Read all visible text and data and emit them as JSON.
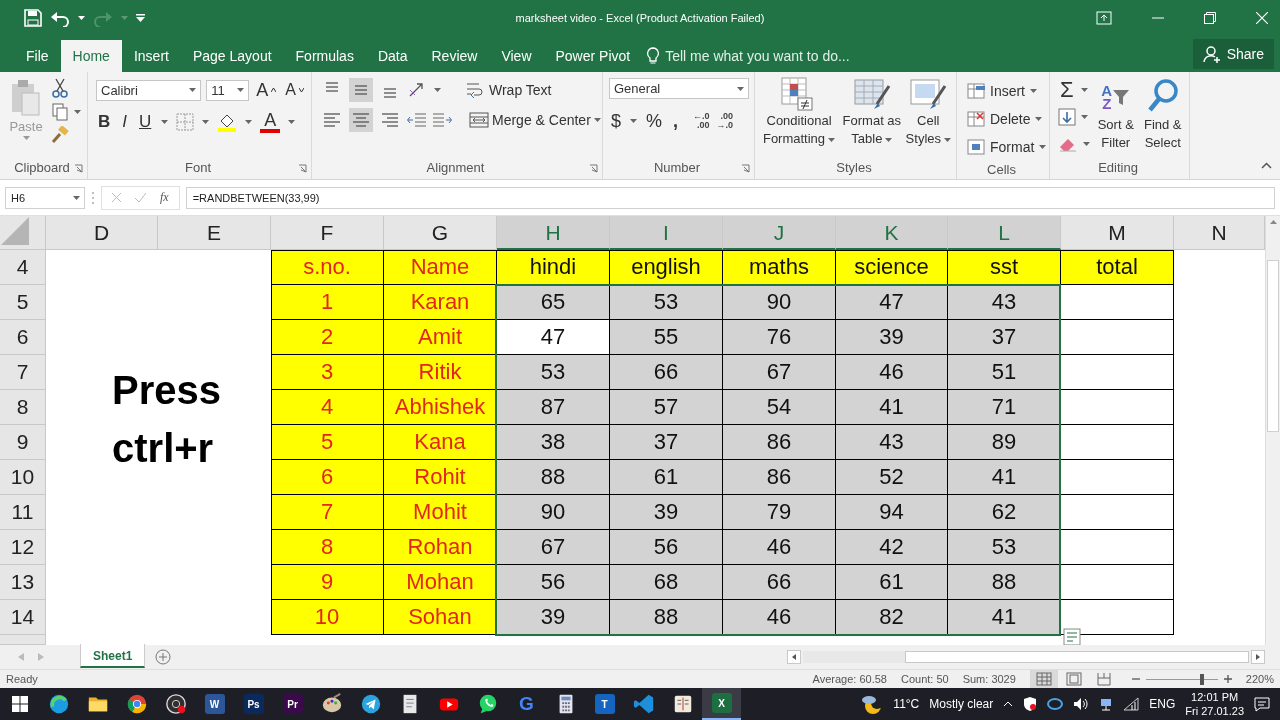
{
  "window": {
    "title": "marksheet video - Excel (Product Activation Failed)"
  },
  "quick_access": {
    "redo_disabled": true
  },
  "ribbon_tabs": [
    {
      "label": "File",
      "selected": false
    },
    {
      "label": "Home",
      "selected": true
    },
    {
      "label": "Insert",
      "selected": false
    },
    {
      "label": "Page Layout",
      "selected": false
    },
    {
      "label": "Formulas",
      "selected": false
    },
    {
      "label": "Data",
      "selected": false
    },
    {
      "label": "Review",
      "selected": false
    },
    {
      "label": "View",
      "selected": false
    },
    {
      "label": "Power Pivot",
      "selected": false
    }
  ],
  "tell_me": {
    "placeholder": "Tell me what you want to do..."
  },
  "share": {
    "label": "Share"
  },
  "ribbon": {
    "clipboard": {
      "label": "Clipboard",
      "paste": {
        "label": "Paste",
        "disabled": true
      }
    },
    "font": {
      "label": "Font",
      "font_name": "Calibri",
      "font_size": "11",
      "grow": "A",
      "shrink": "A",
      "bold": "B",
      "italic": "I",
      "underline": "U",
      "font_color": "A"
    },
    "alignment": {
      "label": "Alignment",
      "vertical": [
        {
          "kind": "top",
          "selected": false
        },
        {
          "kind": "middle",
          "selected": true
        },
        {
          "kind": "bottom",
          "selected": false
        }
      ],
      "horizontal": [
        {
          "kind": "left",
          "selected": false
        },
        {
          "kind": "center",
          "selected": true
        },
        {
          "kind": "right",
          "selected": false
        }
      ],
      "wrap_text": "Wrap Text",
      "merge_center": "Merge & Center"
    },
    "number": {
      "label": "Number",
      "format": "General",
      "currency": "$",
      "percent": "%",
      "comma": ",",
      "increase_decimal": [
        "←.0",
        ".00"
      ],
      "decrease_decimal": [
        ".00",
        "→.0"
      ]
    },
    "styles": {
      "label": "Styles",
      "buttons": [
        {
          "kind": "conditional",
          "label": "Conditional Formatting"
        },
        {
          "kind": "table",
          "label": "Format as Table"
        },
        {
          "kind": "cell",
          "label": "Cell Styles"
        }
      ]
    },
    "cells": {
      "label": "Cells",
      "buttons": [
        {
          "kind": "insert",
          "label": "Insert"
        },
        {
          "kind": "delete",
          "label": "Delete"
        },
        {
          "kind": "format",
          "label": "Format"
        }
      ]
    },
    "editing": {
      "label": "Editing",
      "autosum": "Σ",
      "sort": {
        "label": "Sort & Filter",
        "glyphs": [
          "A",
          "Z"
        ]
      },
      "find": {
        "label": "Find & Select"
      }
    }
  },
  "formula_bar": {
    "name_box": "H6",
    "fx": "fx",
    "formula": "=RANDBETWEEN(33,99)"
  },
  "columns": [
    {
      "label": "D",
      "selected": false
    },
    {
      "label": "E",
      "selected": false
    },
    {
      "label": "F",
      "selected": false
    },
    {
      "label": "G",
      "selected": false
    },
    {
      "label": "H",
      "selected": true
    },
    {
      "label": "I",
      "selected": true
    },
    {
      "label": "J",
      "selected": true
    },
    {
      "label": "K",
      "selected": true
    },
    {
      "label": "L",
      "selected": true
    },
    {
      "label": "M",
      "selected": false
    },
    {
      "label": "N",
      "selected": false
    }
  ],
  "table": {
    "header_row": "4",
    "header": [
      "s.no.",
      "Name",
      "hindi",
      "english",
      "maths",
      "science",
      "sst",
      "total"
    ],
    "rows": [
      {
        "row": "5",
        "sno": "1",
        "name": "Karan",
        "marks": [
          {
            "value": "65",
            "selected": true,
            "active": false
          },
          {
            "value": "53",
            "selected": true,
            "active": false
          },
          {
            "value": "90",
            "selected": true,
            "active": false
          },
          {
            "value": "47",
            "selected": true,
            "active": false
          },
          {
            "value": "43",
            "selected": true,
            "active": false
          }
        ]
      },
      {
        "row": "6",
        "sno": "2",
        "name": "Amit",
        "marks": [
          {
            "value": "47",
            "selected": true,
            "active": true
          },
          {
            "value": "55",
            "selected": true,
            "active": false
          },
          {
            "value": "76",
            "selected": true,
            "active": false
          },
          {
            "value": "39",
            "selected": true,
            "active": false
          },
          {
            "value": "37",
            "selected": true,
            "active": false
          }
        ]
      },
      {
        "row": "7",
        "sno": "3",
        "name": "Ritik",
        "marks": [
          {
            "value": "53",
            "selected": true,
            "active": false
          },
          {
            "value": "66",
            "selected": true,
            "active": false
          },
          {
            "value": "67",
            "selected": true,
            "active": false
          },
          {
            "value": "46",
            "selected": true,
            "active": false
          },
          {
            "value": "51",
            "selected": true,
            "active": false
          }
        ]
      },
      {
        "row": "8",
        "sno": "4",
        "name": "Abhishek",
        "marks": [
          {
            "value": "87",
            "selected": true,
            "active": false
          },
          {
            "value": "57",
            "selected": true,
            "active": false
          },
          {
            "value": "54",
            "selected": true,
            "active": false
          },
          {
            "value": "41",
            "selected": true,
            "active": false
          },
          {
            "value": "71",
            "selected": true,
            "active": false
          }
        ]
      },
      {
        "row": "9",
        "sno": "5",
        "name": "Kana",
        "marks": [
          {
            "value": "38",
            "selected": true,
            "active": false
          },
          {
            "value": "37",
            "selected": true,
            "active": false
          },
          {
            "value": "86",
            "selected": true,
            "active": false
          },
          {
            "value": "43",
            "selected": true,
            "active": false
          },
          {
            "value": "89",
            "selected": true,
            "active": false
          }
        ]
      },
      {
        "row": "10",
        "sno": "6",
        "name": "Rohit",
        "marks": [
          {
            "value": "88",
            "selected": true,
            "active": false
          },
          {
            "value": "61",
            "selected": true,
            "active": false
          },
          {
            "value": "86",
            "selected": true,
            "active": false
          },
          {
            "value": "52",
            "selected": true,
            "active": false
          },
          {
            "value": "41",
            "selected": true,
            "active": false
          }
        ]
      },
      {
        "row": "11",
        "sno": "7",
        "name": "Mohit",
        "marks": [
          {
            "value": "90",
            "selected": true,
            "active": false
          },
          {
            "value": "39",
            "selected": true,
            "active": false
          },
          {
            "value": "79",
            "selected": true,
            "active": false
          },
          {
            "value": "94",
            "selected": true,
            "active": false
          },
          {
            "value": "62",
            "selected": true,
            "active": false
          }
        ]
      },
      {
        "row": "12",
        "sno": "8",
        "name": "Rohan",
        "marks": [
          {
            "value": "67",
            "selected": true,
            "active": false
          },
          {
            "value": "56",
            "selected": true,
            "active": false
          },
          {
            "value": "46",
            "selected": true,
            "active": false
          },
          {
            "value": "42",
            "selected": true,
            "active": false
          },
          {
            "value": "53",
            "selected": true,
            "active": false
          }
        ]
      },
      {
        "row": "13",
        "sno": "9",
        "name": "Mohan",
        "marks": [
          {
            "value": "56",
            "selected": true,
            "active": false
          },
          {
            "value": "68",
            "selected": true,
            "active": false
          },
          {
            "value": "66",
            "selected": true,
            "active": false
          },
          {
            "value": "61",
            "selected": true,
            "active": false
          },
          {
            "value": "88",
            "selected": true,
            "active": false
          }
        ]
      },
      {
        "row": "14",
        "sno": "10",
        "name": "Sohan",
        "marks": [
          {
            "value": "39",
            "selected": true,
            "active": false
          },
          {
            "value": "88",
            "selected": true,
            "active": false
          },
          {
            "value": "46",
            "selected": true,
            "active": false
          },
          {
            "value": "82",
            "selected": true,
            "active": false
          },
          {
            "value": "41",
            "selected": true,
            "active": false
          }
        ]
      }
    ]
  },
  "overlay_text": "Press ctrl+r",
  "sheets": [
    {
      "label": "Sheet1",
      "selected": true
    }
  ],
  "status_bar": {
    "mode": "Ready",
    "average": "Average: 60.58",
    "count": "Count: 50",
    "sum": "Sum: 3029",
    "views": [
      {
        "kind": "normal",
        "selected": true
      },
      {
        "kind": "page_layout",
        "selected": false
      },
      {
        "kind": "page_break",
        "selected": false
      }
    ],
    "zoom": {
      "level": 0.78
    },
    "zoom_label": "220%"
  },
  "taskbar": {
    "apps": [
      {
        "kind": "edge",
        "selected": false
      },
      {
        "kind": "folder",
        "selected": false
      },
      {
        "kind": "chrome",
        "selected": false
      },
      {
        "kind": "obs",
        "selected": false
      },
      {
        "kind": "tile",
        "glyph": "W",
        "color": "#2b579a",
        "selected": false
      },
      {
        "kind": "tile",
        "glyph": "Ps",
        "color": "#0a2a5e",
        "selected": false
      },
      {
        "kind": "tile",
        "glyph": "Pr",
        "color": "#3a0a4a",
        "selected": false
      },
      {
        "kind": "paint",
        "selected": false
      },
      {
        "kind": "telegram",
        "selected": false
      },
      {
        "kind": "doc",
        "selected": false
      },
      {
        "kind": "youtube",
        "selected": false
      },
      {
        "kind": "whatsapp",
        "selected": false
      },
      {
        "kind": "glyph",
        "glyph": "G",
        "color": "#4285f4",
        "selected": false
      },
      {
        "kind": "calc",
        "selected": false
      },
      {
        "kind": "tile",
        "glyph": "T",
        "color": "#1565c0",
        "selected": false
      },
      {
        "kind": "vscode",
        "selected": false
      },
      {
        "kind": "book",
        "selected": false
      },
      {
        "kind": "tile",
        "glyph": "X",
        "color": "#1d6f42",
        "selected": true
      }
    ],
    "weather": {
      "temp": "11°C",
      "text": "Mostly clear"
    },
    "language": "ENG",
    "time": "12:01 PM",
    "date": "Fri 27.01.23"
  }
}
